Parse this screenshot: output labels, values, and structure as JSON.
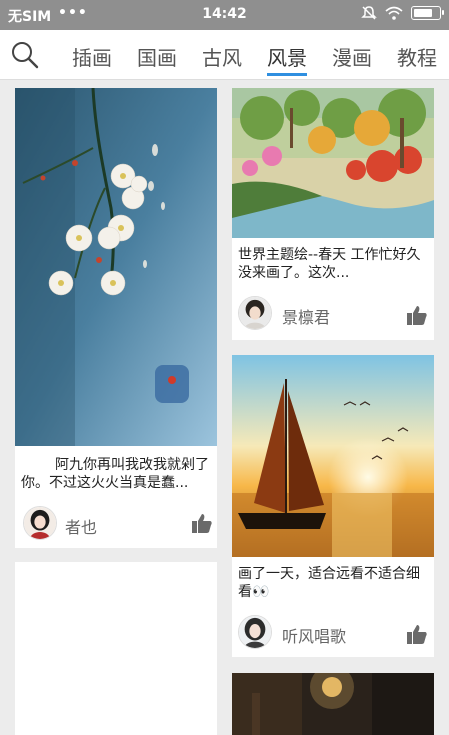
{
  "status": {
    "carrier": "无SIM",
    "dots": "•••",
    "time": "14:42",
    "battery_level": 0.8
  },
  "nav": {
    "tabs": [
      "插画",
      "国画",
      "古风",
      "风景",
      "漫画",
      "教程"
    ],
    "active_tab": "风景"
  },
  "cards": [
    {
      "title": "阿九你再叫我改我就剁了你。不过这火火当真是蠢...",
      "author": "者也"
    },
    {
      "title": "世界主题绘--春天 工作忙好久没来画了。这次...",
      "author": "景檩君"
    },
    {
      "title": "画了一天，适合远看不适合细看👀",
      "author": "听风唱歌"
    }
  ]
}
